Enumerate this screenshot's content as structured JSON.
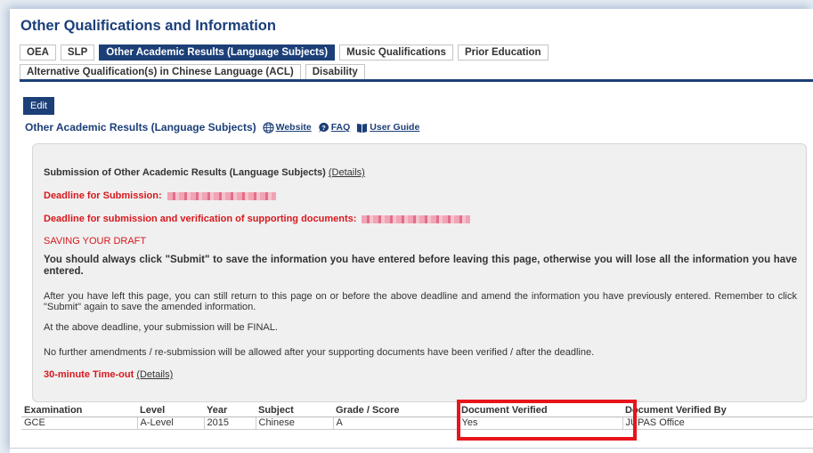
{
  "page_title": "Other Qualifications and Information",
  "tabs": [
    {
      "label": "OEA",
      "active": false
    },
    {
      "label": "SLP",
      "active": false
    },
    {
      "label": "Other Academic Results (Language Subjects)",
      "active": true
    },
    {
      "label": "Music Qualifications",
      "active": false
    },
    {
      "label": "Prior Education",
      "active": false
    },
    {
      "label": "Alternative Qualification(s) in Chinese Language (ACL)",
      "active": false
    },
    {
      "label": "Disability",
      "active": false
    }
  ],
  "edit_label": "Edit",
  "section": {
    "title": "Other Academic Results (Language Subjects)",
    "website_label": "Website",
    "faq_label": "FAQ",
    "guide_label": "User Guide"
  },
  "notice": {
    "submission_text": "Submission of Other Academic Results (Language Subjects)",
    "details_label": "(Details)",
    "deadline_label": "Deadline for Submission:",
    "deadline_docs_label": "Deadline for submission and verification of supporting documents:",
    "saving_heading": "SAVING YOUR DRAFT",
    "warning": "You should always click \"Submit\" to save the information you have entered before leaving this page, otherwise you will lose all the information you have entered.",
    "after_leave": "After you have left this page, you can still return to this page on or before the above deadline and amend the information you have previously entered. Remember to click \"Submit\" again to save the amended information.",
    "final": "At the above deadline, your submission will be FINAL.",
    "no_further": "No further amendments / re-submission will be allowed after your supporting documents have been verified / after the deadline.",
    "timeout_label": "30-minute Time-out",
    "timeout_details": "(Details)"
  },
  "table": {
    "headers": [
      "Examination",
      "Level",
      "Year",
      "Subject",
      "Grade / Score",
      "Document Verified",
      "Document Verified By"
    ],
    "rows": [
      [
        "GCE",
        "A-Level",
        "2015",
        "Chinese",
        "A",
        "Yes",
        "JUPAS Office"
      ]
    ]
  },
  "colors": {
    "brand": "#1c3f78",
    "alert_red": "#d8181d",
    "highlight": "#e8141b"
  }
}
